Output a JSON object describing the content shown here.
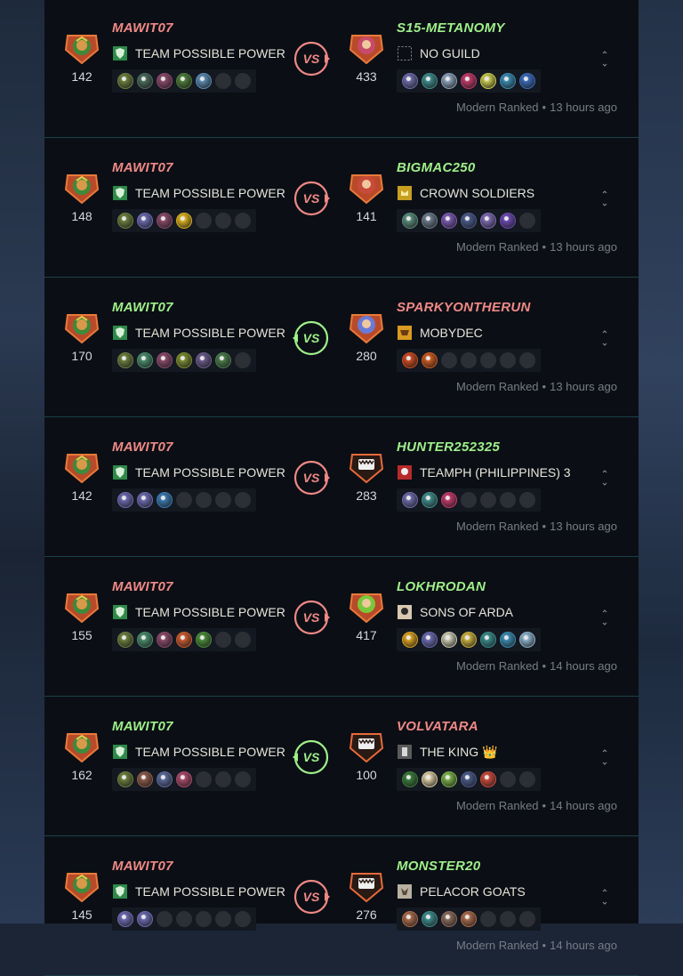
{
  "battles": [
    {
      "result": "loss",
      "player": {
        "name": "MAWIT07",
        "rating": "142",
        "guild": "TEAM POSSIBLE POWER",
        "guild_icon": "green-shield-icon",
        "monsters": [
          "#6b7e3e",
          "#4a6a5a",
          "#8a4a6a",
          "#4e7a3a",
          "#5a8ab0",
          "empty",
          "empty"
        ]
      },
      "opponent": {
        "name": "S15-METANOMY",
        "rating": "433",
        "guild": "NO GUILD",
        "guild_icon": "empty-banner-icon",
        "monsters": [
          "#6a6aa8",
          "#3e8a8a",
          "#8aa0b8",
          "#c03a6a",
          "#c8c850",
          "#3a8ab0",
          "#3a6ab8"
        ]
      },
      "format": "Modern Ranked",
      "time": "13 hours ago"
    },
    {
      "result": "loss",
      "player": {
        "name": "MAWIT07",
        "rating": "148",
        "guild": "TEAM POSSIBLE POWER",
        "guild_icon": "green-shield-icon",
        "monsters": [
          "#6b7e3e",
          "#6a6ab0",
          "#8a4a6a",
          "#d8b020",
          "empty",
          "empty",
          "empty"
        ]
      },
      "opponent": {
        "name": "BIGMAC250",
        "rating": "141",
        "guild": "CROWN SOLDIERS",
        "guild_icon": "crown-banner-icon",
        "monsters": [
          "#5a8a7a",
          "#6a7a8a",
          "#7a5ab0",
          "#4a5a8a",
          "#7a6ab0",
          "#6a4ab0",
          "empty"
        ]
      },
      "format": "Modern Ranked",
      "time": "13 hours ago"
    },
    {
      "result": "win",
      "player": {
        "name": "MAWIT07",
        "rating": "170",
        "guild": "TEAM POSSIBLE POWER",
        "guild_icon": "green-shield-icon",
        "monsters": [
          "#6b7e3e",
          "#4a8a6a",
          "#8a4a6a",
          "#7a8a30",
          "#6a5a8a",
          "#4a7a4a",
          "empty"
        ]
      },
      "opponent": {
        "name": "SPARKYONTHERUN",
        "rating": "280",
        "guild": "MOBYDEC",
        "guild_icon": "gold-banner-icon",
        "monsters": [
          "#c84a20",
          "#c85a20",
          "empty",
          "empty",
          "empty",
          "empty",
          "empty"
        ]
      },
      "format": "Modern Ranked",
      "time": "13 hours ago"
    },
    {
      "result": "loss",
      "player": {
        "name": "MAWIT07",
        "rating": "142",
        "guild": "TEAM POSSIBLE POWER",
        "guild_icon": "green-shield-icon",
        "monsters": [
          "#6a6ab0",
          "#6a6ab0",
          "#3a7ab0",
          "empty",
          "empty",
          "empty",
          "empty"
        ]
      },
      "opponent": {
        "name": "HUNTER252325",
        "rating": "283",
        "guild": "TEAMPH (PHILIPPINES) 3",
        "guild_icon": "red-banner-icon",
        "monsters": [
          "#6a6aa8",
          "#3e8a8a",
          "#c03a6a",
          "empty",
          "empty",
          "empty",
          "empty"
        ]
      },
      "format": "Modern Ranked",
      "time": "13 hours ago"
    },
    {
      "result": "loss",
      "player": {
        "name": "MAWIT07",
        "rating": "155",
        "guild": "TEAM POSSIBLE POWER",
        "guild_icon": "green-shield-icon",
        "monsters": [
          "#6b7e3e",
          "#4a8a6a",
          "#8a4a6a",
          "#c85a30",
          "#4a8a3a",
          "empty",
          "empty"
        ]
      },
      "opponent": {
        "name": "LOKHRODAN",
        "rating": "417",
        "guild": "SONS OF ARDA",
        "guild_icon": "skull-banner-icon",
        "monsters": [
          "#d8a020",
          "#6a6ab0",
          "#c8c8b0",
          "#c8b040",
          "#3a8a8a",
          "#3a8ab0",
          "#8ab0c8"
        ]
      },
      "format": "Modern Ranked",
      "time": "14 hours ago"
    },
    {
      "result": "win",
      "player": {
        "name": "MAWIT07",
        "rating": "162",
        "guild": "TEAM POSSIBLE POWER",
        "guild_icon": "green-shield-icon",
        "monsters": [
          "#6b7e3e",
          "#8a5a4a",
          "#5a6a9a",
          "#a84a6a",
          "empty",
          "empty",
          "empty"
        ]
      },
      "opponent": {
        "name": "VOLVATARA",
        "rating": "100",
        "guild": "THE KING 👑",
        "guild_icon": "king-banner-icon",
        "monsters": [
          "#3a7a3a",
          "#d8c8a0",
          "#7ab04a",
          "#4a5a8a",
          "#c84a3a",
          "empty",
          "empty"
        ]
      },
      "format": "Modern Ranked",
      "time": "14 hours ago"
    },
    {
      "result": "loss",
      "player": {
        "name": "MAWIT07",
        "rating": "145",
        "guild": "TEAM POSSIBLE POWER",
        "guild_icon": "green-shield-icon",
        "monsters": [
          "#6a6ab0",
          "#6a6ab0",
          "empty",
          "empty",
          "empty",
          "empty",
          "empty"
        ]
      },
      "opponent": {
        "name": "MONSTER20",
        "rating": "276",
        "guild": "PELACOR GOATS",
        "guild_icon": "goat-banner-icon",
        "monsters": [
          "#a86a4a",
          "#3e8a8a",
          "#8a6a5a",
          "#a86a4a",
          "empty",
          "empty",
          "empty"
        ]
      },
      "format": "Modern Ranked",
      "time": "14 hours ago"
    }
  ],
  "colors": {
    "loss": "#f08986",
    "win": "#9ff08a",
    "panel": "#0b0f15",
    "divider": "#1d4048"
  }
}
